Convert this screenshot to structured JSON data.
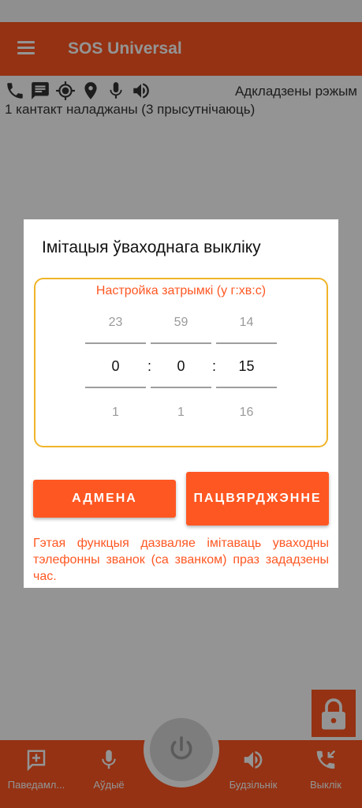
{
  "app": {
    "title": "SOS Universal",
    "accent_color": "#ff5722"
  },
  "header": {
    "menu_icon": "hamburger-icon",
    "status_icons": [
      "phone-icon",
      "message-icon",
      "gps-target-icon",
      "location-pin-icon",
      "microphone-icon",
      "speaker-icon"
    ],
    "mode_label": "Адкладзены рэжым",
    "contacts_label": "1 кантакт наладжаны (3 прысутнічаюць)"
  },
  "dialog": {
    "title": "Імітацыя ўваходнага выкліку",
    "picker_label": "Настройка затрымкі (у г:хв:с)",
    "hours": {
      "prev": "23",
      "current": "0",
      "next": "1"
    },
    "minutes": {
      "prev": "59",
      "current": "0",
      "next": "1"
    },
    "seconds": {
      "prev": "14",
      "current": "15",
      "next": "16"
    },
    "separator": ":",
    "cancel_label": "АДМЕНА",
    "confirm_label": "ПАЦВЯРДЖЭННЕ",
    "description": "Гэтая функцыя дазваляе імітаваць уваходны тэлефонны званок (са званком) праз зададзены час."
  },
  "bottom_nav": {
    "items": [
      {
        "label": "Паведамл...",
        "icon": "add-message-icon"
      },
      {
        "label": "Аўдыё",
        "icon": "microphone-icon"
      },
      {
        "label": "Будзільнік",
        "icon": "speaker-icon"
      },
      {
        "label": "Выклік",
        "icon": "incoming-call-icon"
      }
    ],
    "center_icon": "power-icon"
  },
  "lock_icon": "lock-icon"
}
